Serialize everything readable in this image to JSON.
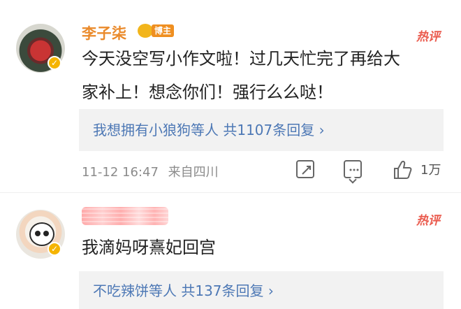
{
  "comment_1": {
    "user_name": "李子柒",
    "badge_label": "博主",
    "hot_label": "热评",
    "text_line_1": "今天没空写小作文啦！过几天忙完了再给大",
    "text_line_2": "家补上！想念你们！强行么么哒！",
    "reply_summary": "我想拥有小狼狗等人 共1107条回复 ›",
    "timestamp": "11-12 16:47",
    "source": "来自四川",
    "like_count": "1万",
    "colors": {
      "user_name": "#ea8a2b",
      "hot_label": "#ea5a4d",
      "reply_link": "#4d78b5"
    }
  },
  "comment_2": {
    "hot_label": "热评",
    "text": "我滴妈呀熹妃回宫",
    "reply_summary": "不吃辣饼等人 共137条回复 ›"
  }
}
